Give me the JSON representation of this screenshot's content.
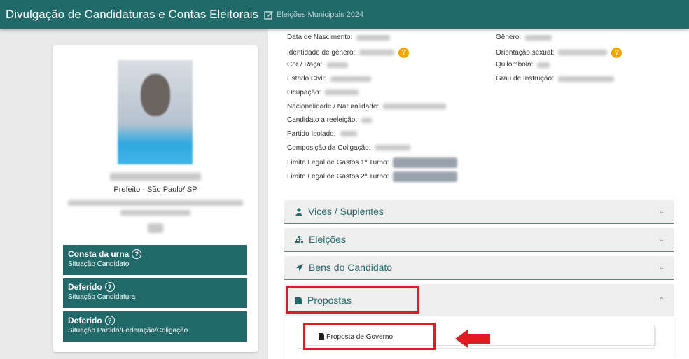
{
  "header": {
    "title": "Divulgação de Candidaturas e Contas Eleitorais",
    "election": "Eleições Municipais 2024"
  },
  "candidate": {
    "cargo": "Prefeito - São Paulo/ SP",
    "statuses": [
      {
        "value": "Consta da urna",
        "label": "Situação Candidato"
      },
      {
        "value": "Deferido",
        "label": "Situação Candidatura"
      },
      {
        "value": "Deferido",
        "label": "Situação Partido/Federação/Coligação"
      }
    ]
  },
  "details": {
    "left": [
      "Data de Nascimento:",
      "Identidade de gênero:",
      "Cor / Raça:",
      "Estado Civil:",
      "Ocupação:",
      "Nacionalidade / Naturalidade:",
      "Candidato a reeleição:",
      "Partido Isolado:",
      "Composição da Coligação:",
      "Limite Legal de Gastos 1º Turno:",
      "Limite Legal de Gastos 2º Turno:"
    ],
    "right": [
      "Gênero:",
      "Orientação sexual:",
      "Quilombola:",
      "Grau de Instrução:"
    ],
    "help": "?"
  },
  "accordions": [
    {
      "label": "Vices / Suplentes"
    },
    {
      "label": "Eleições"
    },
    {
      "label": "Bens do Candidato"
    },
    {
      "label": "Propostas"
    }
  ],
  "propostas": {
    "item": "Proposta de Governo"
  },
  "colors": {
    "primary": "#226a6a",
    "highlight": "#e21a23",
    "help": "#f4a400"
  }
}
